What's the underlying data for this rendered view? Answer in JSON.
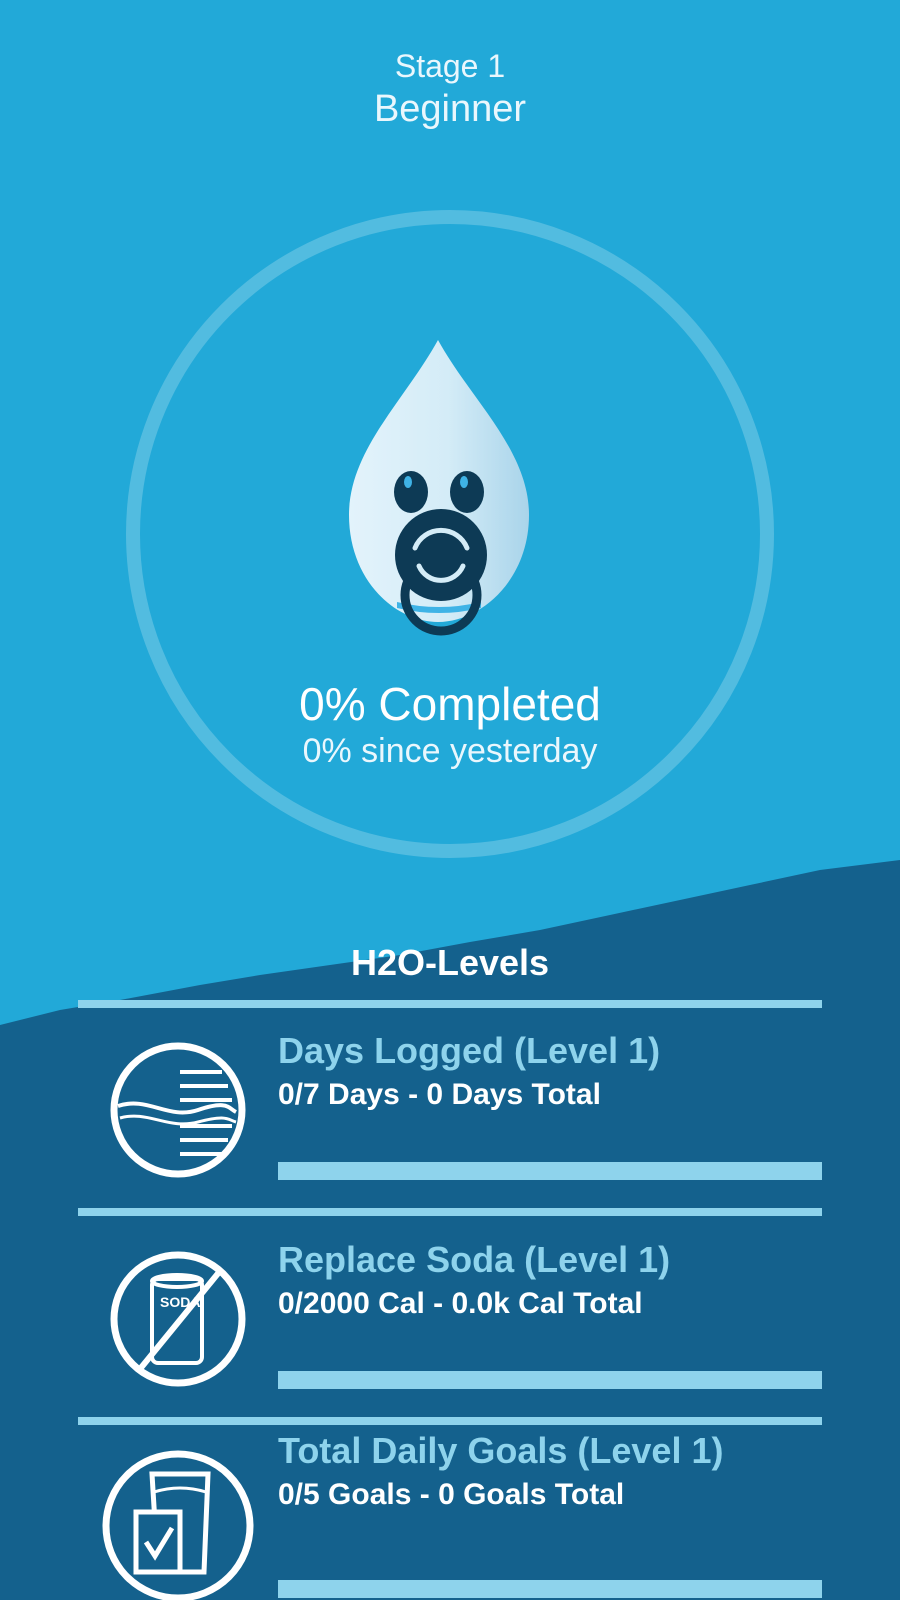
{
  "header": {
    "stage": "Stage 1",
    "stage_name": "Beginner"
  },
  "progress": {
    "completed_label": "0% Completed",
    "since_label": "0% since yesterday",
    "completed_fraction": 0
  },
  "levels_section": {
    "title": "H2O-Levels",
    "items": [
      {
        "icon": "water-lines-icon",
        "name": "Days Logged (Level 1)",
        "detail": "0/7 Days - 0 Days Total",
        "progress_fraction": 0
      },
      {
        "icon": "no-soda-icon",
        "name": "Replace Soda (Level 1)",
        "detail": "0/2000 Cal - 0.0k Cal Total",
        "progress_fraction": 0
      },
      {
        "icon": "glass-checklist-icon",
        "name": "Total Daily Goals (Level 1)",
        "detail": "0/5 Goals - 0 Goals Total",
        "progress_fraction": 0
      }
    ]
  },
  "colors": {
    "sky": "#22a9d8",
    "deep": "#14618d",
    "accent": "#8ed3ec",
    "mascot_dark": "#0d3a55"
  },
  "icon_text": {
    "soda": "SODA"
  }
}
